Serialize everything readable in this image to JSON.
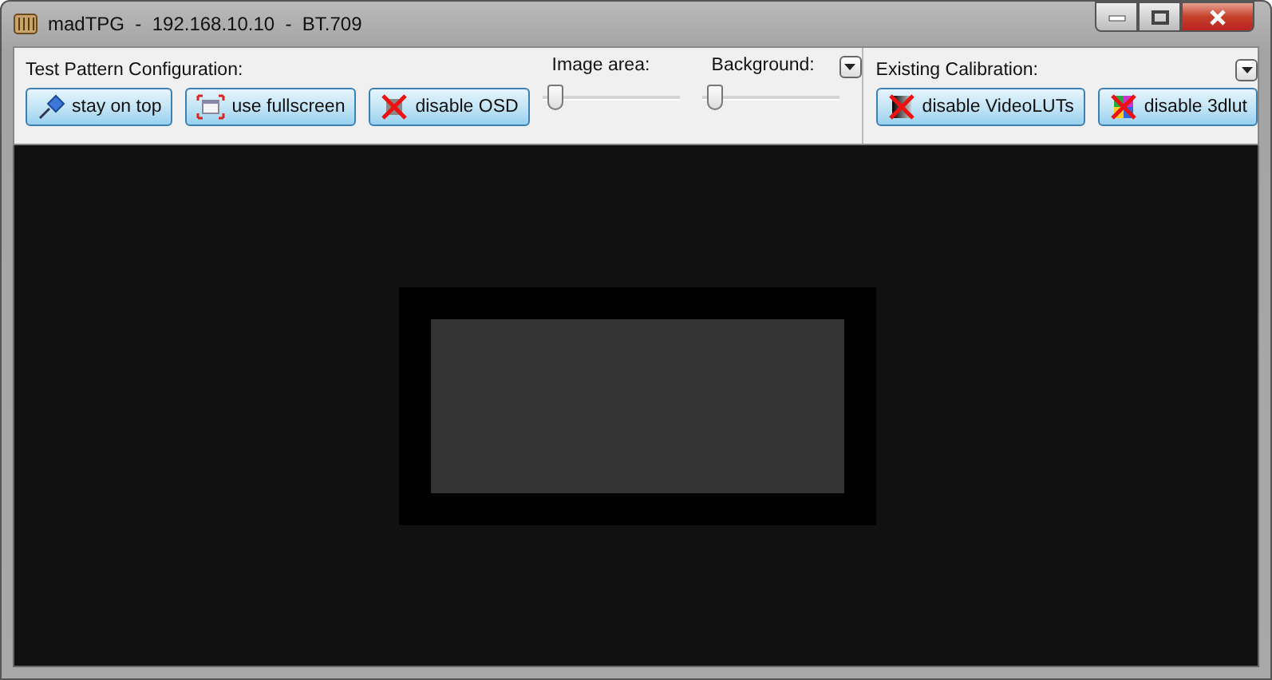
{
  "window": {
    "title": "madTPG  -  192.168.10.10  -  BT.709"
  },
  "test_pattern": {
    "label": "Test Pattern Configuration:",
    "buttons": [
      {
        "label": "stay on top",
        "kind": "pin",
        "on": true
      },
      {
        "label": "use fullscreen",
        "kind": "fullscreen",
        "on": true
      },
      {
        "label": "disable OSD",
        "kind": "osd",
        "on": true
      }
    ]
  },
  "sliders": [
    {
      "label": "Image area:",
      "level": 0.05
    },
    {
      "label": "Background:",
      "level": 0.05
    }
  ],
  "calibration": {
    "label": "Existing Calibration:",
    "buttons": [
      {
        "label": "disable VideoLUTs",
        "kind": "videoluts",
        "on": true
      },
      {
        "label": "disable 3dlut",
        "kind": "colorcube",
        "on": true
      }
    ]
  }
}
